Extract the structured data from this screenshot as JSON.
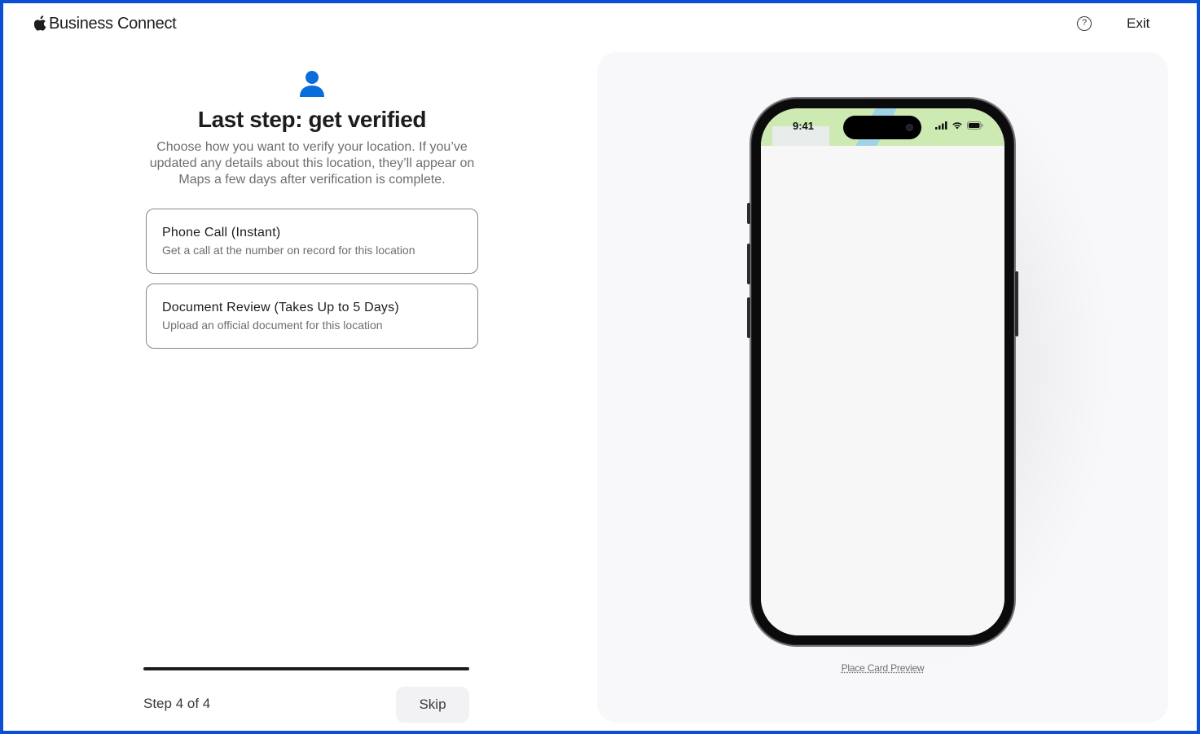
{
  "header": {
    "brand_name": "Business Connect",
    "help_label": "?",
    "exit_label": "Exit"
  },
  "verify": {
    "title": "Last step: get verified",
    "description": "Choose how you want to verify your location. If you’ve updated any details about this location, they’ll appear on Maps a few days after verification is complete.",
    "options": [
      {
        "title": "Phone Call (Instant)",
        "subtitle": "Get a call at the number on record for this location"
      },
      {
        "title": "Document Review (Takes Up to 5 Days)",
        "subtitle": "Upload an official document for this location"
      }
    ]
  },
  "footer": {
    "step_label": "Step 4 of 4",
    "progress_fraction": 1.0,
    "skip_label": "Skip"
  },
  "preview": {
    "status_time": "9:41",
    "caption": "Place Card Preview"
  },
  "colors": {
    "accent": "#0a6ddc",
    "frame_border": "#0a4fd6",
    "map_green": "#cdeab3",
    "map_water": "#9fd3e6"
  },
  "icons": {
    "brand": "apple-logo-icon",
    "help": "question-circle-icon",
    "step": "person-icon",
    "signal": "cellular-signal-icon",
    "wifi": "wifi-icon",
    "battery": "battery-icon"
  }
}
